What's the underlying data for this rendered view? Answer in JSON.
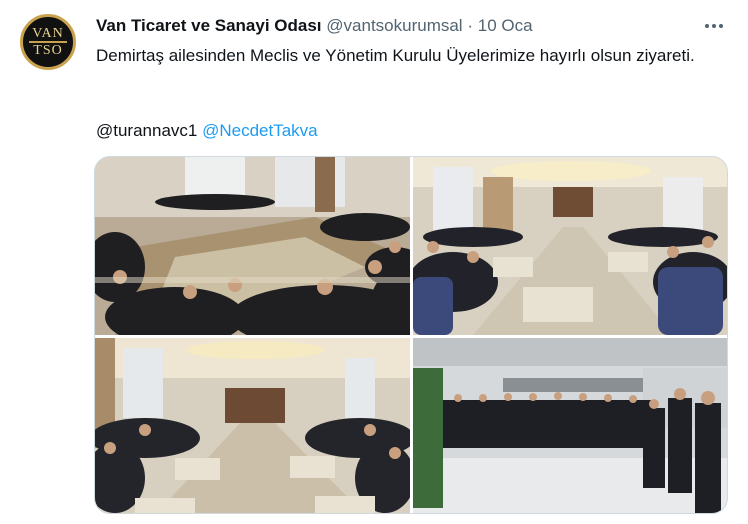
{
  "account": {
    "display_name": "Van Ticaret ve Sanayi Odası",
    "handle": "@vantsokurumsal",
    "separator": "·",
    "date": "10 Oca",
    "avatar_logo_lines": [
      "VAN",
      "TSO"
    ]
  },
  "tweet": {
    "text": "Demirtaş ailesinden Meclis ve Yönetim Kurulu Üyelerimize hayırlı olsun ziyareti.",
    "mention_plain": "@turannavc1",
    "mention_link": "@NecdetTakva"
  },
  "media": {
    "photos": [
      {
        "subject": "meeting-room-seated-group"
      },
      {
        "subject": "meeting-room-seated-group-wide"
      },
      {
        "subject": "meeting-room-seated-group-long-view"
      },
      {
        "subject": "standing-group-photo-lobby"
      }
    ]
  },
  "colors": {
    "link": "#1d9bf0",
    "secondary_text": "#536471",
    "border": "#cfd9de"
  }
}
